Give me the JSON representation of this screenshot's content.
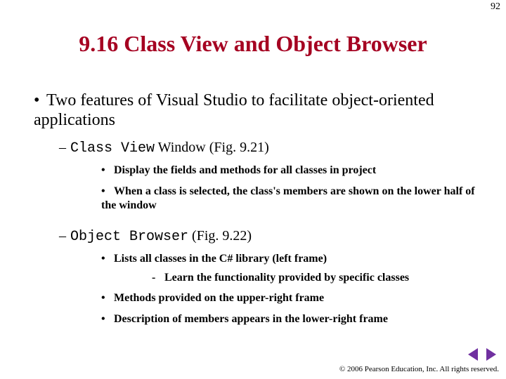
{
  "pageNumber": "92",
  "title": "9.16 Class View and Object Browser",
  "bullet1": {
    "text": "Two features of Visual Studio to facilitate object-oriented applications"
  },
  "section1": {
    "codeTerm": "Class View",
    "windowText": " Window (Fig. 9.21)",
    "sub1": "Display the fields and methods for all classes in project",
    "sub2": "When a class is selected, the class's members are shown on the lower half of the window"
  },
  "section2": {
    "codeTerm": "Object Browser",
    "windowText": " (Fig. 9.22)",
    "sub1": "Lists all classes in the C# library (left frame)",
    "sub1a": "Learn the functionality provided by specific classes",
    "sub2": "Methods provided on the upper-right frame",
    "sub3": "Description of members appears in the lower-right frame"
  },
  "footer": "© 2006 Pearson Education, Inc.  All rights reserved."
}
